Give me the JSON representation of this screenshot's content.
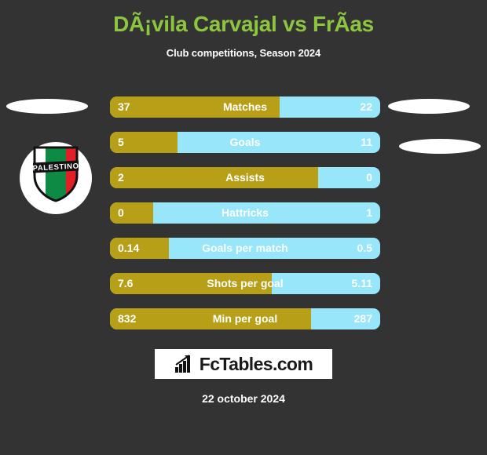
{
  "header": {
    "title": "DÃ¡vila Carvajal vs FrÃ­as",
    "subtitle": "Club competitions, Season 2024"
  },
  "colors": {
    "background": "#333333",
    "title_green": "#8CC63E",
    "home_gold": "#B7A017",
    "away_blue": "#97E6FA",
    "text_white": "#FFFFFF"
  },
  "badge": {
    "club_name": "PALESTINO",
    "stripe_white": "#FFFFFF",
    "stripe_green": "#0F8A45",
    "stripe_red": "#E31E24",
    "banner": "#111111"
  },
  "chart_data": {
    "type": "bar",
    "title": "DÃ¡vila Carvajal vs FrÃ­as",
    "subtitle": "Club competitions, Season 2024",
    "orientation": "horizontal-split",
    "series": [
      {
        "name": "DÃ¡vila Carvajal",
        "color": "#B7A017",
        "side": "left"
      },
      {
        "name": "FrÃ­as",
        "color": "#97E6FA",
        "side": "right"
      }
    ],
    "categories": [
      "Matches",
      "Goals",
      "Assists",
      "Hattricks",
      "Goals per match",
      "Shots per goal",
      "Min per goal"
    ],
    "rows": [
      {
        "label": "Matches",
        "left": "37",
        "right": "22",
        "left_pct": 62.7
      },
      {
        "label": "Goals",
        "left": "5",
        "right": "11",
        "left_pct": 25.0
      },
      {
        "label": "Assists",
        "left": "2",
        "right": "0",
        "left_pct": 77.0
      },
      {
        "label": "Hattricks",
        "left": "0",
        "right": "1",
        "left_pct": 16.0
      },
      {
        "label": "Goals per match",
        "left": "0.14",
        "right": "0.5",
        "left_pct": 21.9
      },
      {
        "label": "Shots per goal",
        "left": "7.6",
        "right": "5.11",
        "left_pct": 59.8
      },
      {
        "label": "Min per goal",
        "left": "832",
        "right": "287",
        "left_pct": 74.3
      }
    ]
  },
  "footer": {
    "logo_text": "FcTables.com",
    "logo_icon": "bar-chart-icon",
    "date": "22 october 2024"
  }
}
